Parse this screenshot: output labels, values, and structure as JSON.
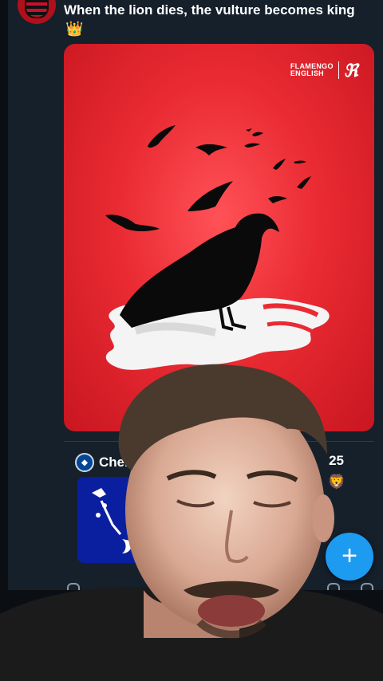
{
  "post": {
    "text": "When the lion dies, the vulture becomes king",
    "emoji": "👑",
    "media": {
      "brand_top": "FLAMENGO",
      "brand_bottom": "ENGLISH",
      "brand_monogram": "CRF"
    }
  },
  "next_post": {
    "team_prefix": "Chels",
    "right_text": "25",
    "emoji": "🦁",
    "badge_icon": "chelsea-badge-icon"
  },
  "compose_button": {
    "label": "+"
  },
  "colors": {
    "feed_background": "#15202b",
    "media_red": "#ea2b33",
    "fab_blue": "#1d9bf0",
    "chelsea_blue": "#0a1fa0"
  }
}
